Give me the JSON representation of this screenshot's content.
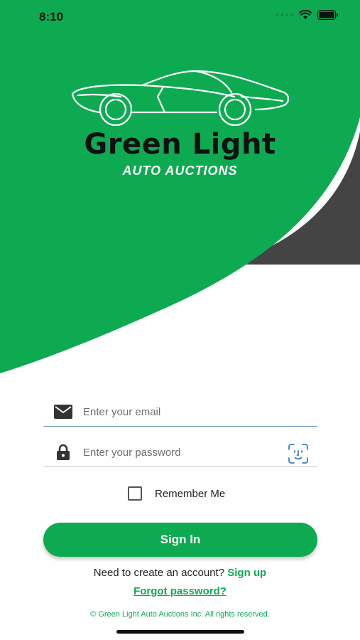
{
  "status_bar": {
    "time": "8:10"
  },
  "brand": {
    "title": "Green Light",
    "subtitle": "AUTO AUCTIONS"
  },
  "form": {
    "email_placeholder": "Enter your email",
    "password_placeholder": "Enter your password",
    "remember_label": "Remember Me",
    "signin_label": "Sign In"
  },
  "links": {
    "signup_prompt": "Need to create an account?",
    "signup_label": "Sign up",
    "forgot_label": "Forgot password?"
  },
  "footer": {
    "copyright": "© Green Light Auto Auctions Inc. All rights reserved."
  },
  "colors": {
    "brand_green": "#0eaa52",
    "dark_swoosh": "#444444"
  },
  "icons": {
    "email": "mail-icon",
    "password": "lock-icon",
    "biometric": "face-id-icon",
    "logo": "car-icon"
  }
}
